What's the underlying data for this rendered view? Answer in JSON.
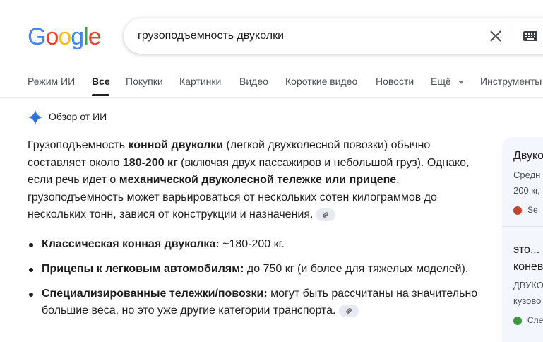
{
  "logo": {
    "text": "Google"
  },
  "search": {
    "query": "грузоподъемность двуколки"
  },
  "tabs": [
    {
      "label": "Режим ИИ",
      "active": false
    },
    {
      "label": "Все",
      "active": true
    },
    {
      "label": "Покупки",
      "active": false
    },
    {
      "label": "Картинки",
      "active": false
    },
    {
      "label": "Видео",
      "active": false
    },
    {
      "label": "Короткие видео",
      "active": false
    },
    {
      "label": "Новости",
      "active": false
    },
    {
      "label": "Ещё",
      "active": false
    },
    {
      "label": "Инструменты",
      "active": false
    }
  ],
  "ai_overview": {
    "title": "Обзор от ИИ",
    "p1": "Грузоподъемность ",
    "p1_b": "конной двуколки",
    "p2": " (легкой двухколесной повозки) обычно составляет около ",
    "p2_b": "180-200 кг",
    "p3": " (включая двух пассажиров и небольшой груз). Однако, если речь идет о ",
    "p3_b": "механической двуколесной тележке или прицепе",
    "p4": ", грузоподъемность может варьироваться от нескольких сотен килограммов до нескольких тонн, завися от конструкции и назначения.",
    "bullets": [
      {
        "bold": "Классическая конная двуколка:",
        "text": " ~180-200 кг."
      },
      {
        "bold": "Прицепы к легковым автомобилям:",
        "text": " до 750 кг (и более для тяжелых моделей)."
      },
      {
        "bold": "Специализированные тележки/повозки:",
        "text": " могут быть рассчитаны на значительно большие веса, но это уже другие категории транспорта."
      }
    ]
  },
  "side_panel": {
    "card1_title": "Двуко",
    "card1_line1": "Средн",
    "card1_line2": "200 кг,",
    "card1_source": "Se",
    "card2_title1": "это...",
    "card2_title2": "конев",
    "card2_line1": "ДВУКО",
    "card2_line2": "кузово",
    "card2_source": "Сле"
  },
  "colors": {
    "accent": "#1a73e8",
    "text": "#1f1f1f",
    "muted": "#4d5156",
    "card_bg": "#f3f6fc"
  }
}
